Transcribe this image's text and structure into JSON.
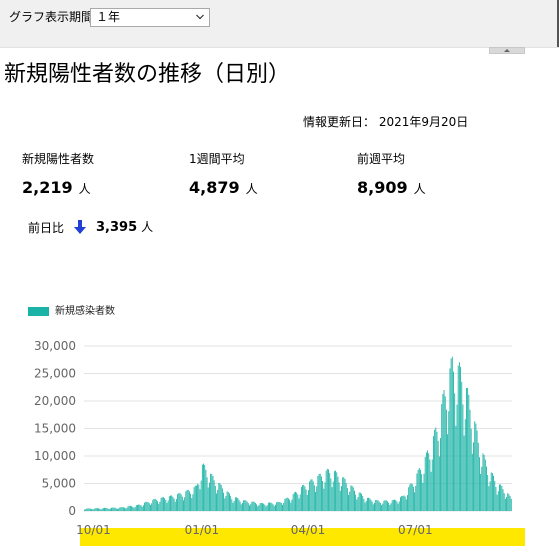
{
  "toolbar": {
    "period_label": "グラフ表示期間",
    "period_value": "１年",
    "select_icon": "chevron-down-icon",
    "collapse_icon": "caret-up-icon"
  },
  "page": {
    "title": "新規陽性者数の推移（日別）",
    "updated": "情報更新日： 2021年9月20日"
  },
  "stats": {
    "new_cases": {
      "label": "新規陽性者数",
      "value": "2,219",
      "unit": "人"
    },
    "weekly_avg": {
      "label": "1週間平均",
      "value": "4,879",
      "unit": "人"
    },
    "prev_week_avg": {
      "label": "前週平均",
      "value": "8,909",
      "unit": "人"
    },
    "prev_day": {
      "label": "前日比",
      "value": "3,395",
      "unit": "人",
      "direction": "down",
      "direction_icon": "arrow-down-icon"
    }
  },
  "colors": {
    "bar": "#1bb3a5",
    "arrow": "#1f3fd6",
    "band": "#ffe800"
  },
  "chart_data": {
    "type": "bar",
    "legend": [
      "新規感染者数"
    ],
    "legend_position": "top-left",
    "grid": true,
    "ylim": [
      0,
      30000
    ],
    "y_ticks": [
      "30,000",
      "25,000",
      "20,000",
      "15,000",
      "10,000",
      "5,000",
      "0"
    ],
    "x_ticks": [
      "10/01",
      "01/01",
      "04/01",
      "07/01"
    ],
    "x_tick_days": [
      8,
      100,
      190,
      281
    ],
    "start_date": "2020-09-23",
    "end_date": "2021-09-20",
    "days": 363,
    "series": [
      {
        "name": "新規感染者数",
        "points": [
          [
            0,
            400
          ],
          [
            15,
            500
          ],
          [
            30,
            600
          ],
          [
            45,
            1000
          ],
          [
            60,
            2000
          ],
          [
            75,
            2600
          ],
          [
            85,
            3200
          ],
          [
            95,
            4200
          ],
          [
            100,
            7800
          ],
          [
            103,
            7500
          ],
          [
            108,
            6000
          ],
          [
            115,
            4500
          ],
          [
            125,
            2500
          ],
          [
            135,
            1800
          ],
          [
            150,
            1300
          ],
          [
            165,
            1500
          ],
          [
            175,
            2500
          ],
          [
            185,
            4200
          ],
          [
            195,
            5500
          ],
          [
            205,
            6800
          ],
          [
            210,
            7000
          ],
          [
            220,
            5500
          ],
          [
            230,
            3500
          ],
          [
            240,
            2200
          ],
          [
            250,
            1700
          ],
          [
            262,
            1800
          ],
          [
            270,
            2500
          ],
          [
            280,
            5500
          ],
          [
            290,
            9500
          ],
          [
            295,
            12000
          ],
          [
            300,
            15000
          ],
          [
            305,
            20000
          ],
          [
            308,
            22500
          ],
          [
            312,
            25500
          ],
          [
            316,
            24800
          ],
          [
            320,
            23500
          ],
          [
            325,
            20000
          ],
          [
            330,
            16000
          ],
          [
            335,
            11500
          ],
          [
            340,
            8500
          ],
          [
            345,
            6500
          ],
          [
            350,
            4800
          ],
          [
            356,
            3800
          ],
          [
            362,
            2219
          ]
        ]
      }
    ]
  }
}
